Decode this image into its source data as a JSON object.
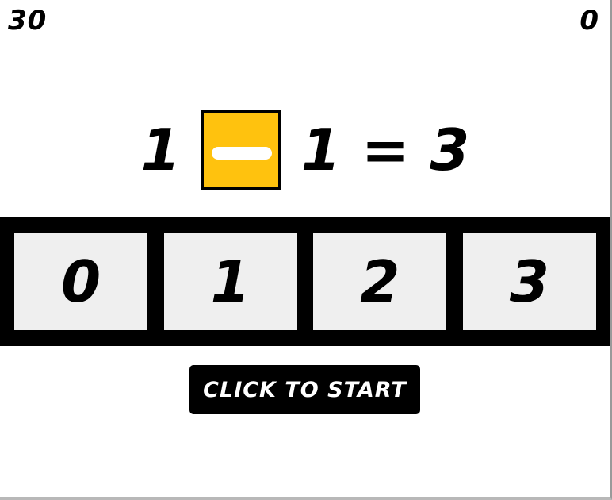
{
  "hud": {
    "timer": "30",
    "score": "0"
  },
  "equation": {
    "left_operand": "1",
    "operator_icon": "minus-icon",
    "right_operand": "1",
    "equals": "=",
    "result": "3"
  },
  "answers": [
    "0",
    "1",
    "2",
    "3"
  ],
  "start_button": {
    "label": "CLICK TO START"
  },
  "colors": {
    "operator_box": "#ffc20e",
    "answer_bar": "#000000",
    "answer_button": "#efefef",
    "start_button": "#000000"
  }
}
